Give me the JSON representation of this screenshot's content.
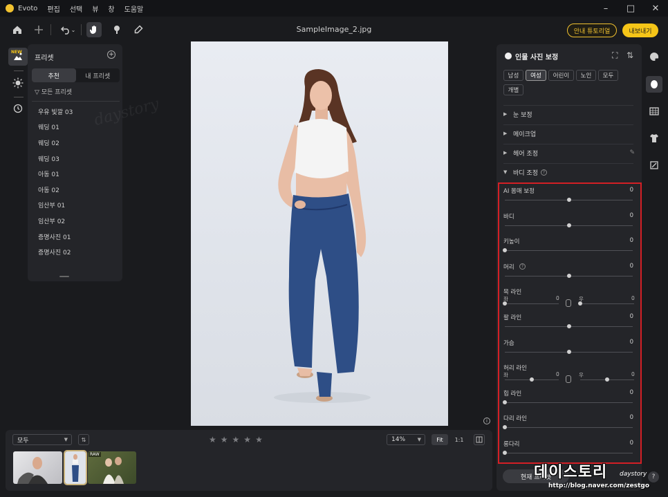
{
  "app": {
    "name": "Evoto",
    "menu": [
      "편집",
      "선택",
      "뷰",
      "창",
      "도움말"
    ],
    "document_title": "SampleImage_2.jpg",
    "tutorial_label": "안내 튜토리얼",
    "export_label": "내보내기"
  },
  "left_rail": {
    "new_badge": "NEW"
  },
  "preset_panel": {
    "title": "프리셋",
    "tabs": [
      "추천",
      "내 프리셋"
    ],
    "active_tab": "추천",
    "filter_label": "모든 프리셋",
    "items": [
      "우유 빛깔 03",
      "웨딩 01",
      "웨딩 02",
      "웨딩 03",
      "아동 01",
      "아동 02",
      "임산부 01",
      "임산부 02",
      "증명사진 01",
      "증명사진 02"
    ]
  },
  "right_panel": {
    "title": "인물 사진 보정",
    "chips": [
      "남성",
      "여성",
      "어린이",
      "노인",
      "모두",
      "개별"
    ],
    "active_chip": "여성",
    "sections": [
      {
        "label": "눈 보정",
        "expanded": false
      },
      {
        "label": "메이크업",
        "expanded": false
      },
      {
        "label": "헤어 조정",
        "expanded": false
      },
      {
        "label": "바디 조정",
        "expanded": true
      }
    ],
    "sliders": [
      {
        "label": "AI 몸매 보정",
        "value": "0",
        "level": 0.5
      },
      {
        "label": "바디",
        "value": "0",
        "level": 0.5
      },
      {
        "label": "키높이",
        "value": "0",
        "level": 0
      },
      {
        "label": "머리",
        "value": "0",
        "level": 0.5,
        "has_help": true
      },
      {
        "label": "목 라인",
        "dual": true,
        "left_label": "좌",
        "left_value": "0",
        "left_level": 0,
        "right_label": "우",
        "right_value": "0",
        "right_level": 0
      },
      {
        "label": "팔 라인",
        "value": "0",
        "level": 0.5
      },
      {
        "label": "가슴",
        "value": "0",
        "level": 0.5
      },
      {
        "label": "허리 라인",
        "dual": true,
        "left_label": "좌",
        "left_value": "0",
        "left_level": 0.5,
        "right_label": "우",
        "right_value": "0",
        "right_level": 0.5
      },
      {
        "label": "힙 라인",
        "value": "0",
        "level": 0
      },
      {
        "label": "다리 라인",
        "value": "0",
        "level": 0
      },
      {
        "label": "롱다리",
        "value": "0",
        "level": 0
      }
    ],
    "preset_button": "현재 프리셋",
    "highlight_color": "#d41f25"
  },
  "overlay": {
    "brand": "데이스토리",
    "brand_sub": "daystory",
    "url": "http://blog.naver.com/zestgo",
    "canvas_watermark": "daystory"
  },
  "filmstrip": {
    "filter_value": "모두",
    "rating_stars": 5,
    "zoom_value": "14%",
    "fit_label": "Fit",
    "one_to_one_label": "1:1",
    "raw_badge": "RAW"
  },
  "colors": {
    "accent": "#f5c518",
    "panel": "#242529",
    "background": "#1a1b1e"
  }
}
